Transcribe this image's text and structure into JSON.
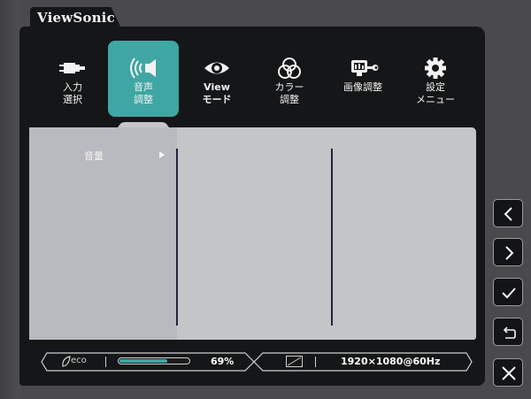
{
  "brand": "ViewSonic",
  "colors": {
    "accent": "#3fa6a4",
    "panel": "#c4c5c7",
    "osd_bg": "#151617"
  },
  "menu": [
    {
      "icon": "input-connector-icon",
      "label": "入力\n選択",
      "active": false
    },
    {
      "icon": "speaker-icon",
      "label": "音声\n調整",
      "active": true
    },
    {
      "icon": "eye-icon",
      "label": "View\nモード",
      "active": false
    },
    {
      "icon": "color-circles-icon",
      "label": "カラー\n調整",
      "active": false
    },
    {
      "icon": "monitor-wrench-icon",
      "label": "画像調整",
      "active": false
    },
    {
      "icon": "gear-icon",
      "label": "設定\nメニュー",
      "active": false
    }
  ],
  "submenu": {
    "items": [
      "音量"
    ]
  },
  "status": {
    "eco_label": "eco",
    "eco_percent": "69%",
    "eco_level": 0.69,
    "resolution": "1920×1080@60Hz"
  },
  "side_buttons": [
    {
      "icon": "chevron-left-icon"
    },
    {
      "icon": "chevron-right-icon"
    },
    {
      "icon": "check-icon"
    },
    {
      "icon": "return-icon"
    },
    {
      "icon": "close-icon"
    }
  ]
}
